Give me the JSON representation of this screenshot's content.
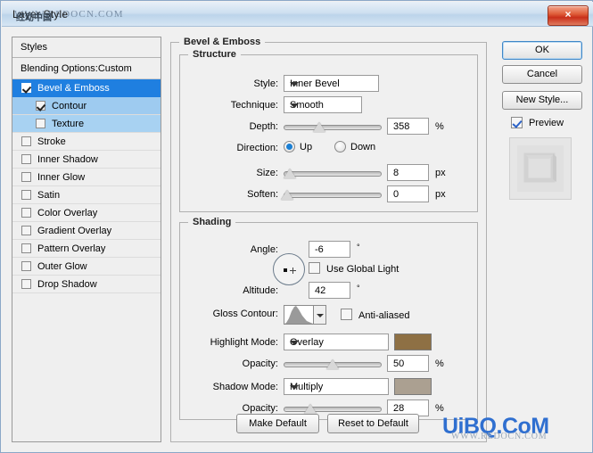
{
  "window": {
    "title": "Layer Style",
    "watermark_title": "WWW.REDOCN.COM",
    "watermark_title_cn": "红动中国",
    "close_icon": "×"
  },
  "styles_panel": {
    "header": "Styles",
    "blending_options": "Blending Options:Custom",
    "items": [
      {
        "label": "Bevel & Emboss",
        "checked": true,
        "selected": true,
        "level": 0
      },
      {
        "label": "Contour",
        "checked": true,
        "selected": false,
        "level": 1
      },
      {
        "label": "Texture",
        "checked": false,
        "selected": false,
        "level": 1
      },
      {
        "label": "Stroke",
        "checked": false,
        "selected": false,
        "level": 0
      },
      {
        "label": "Inner Shadow",
        "checked": false,
        "selected": false,
        "level": 0
      },
      {
        "label": "Inner Glow",
        "checked": false,
        "selected": false,
        "level": 0
      },
      {
        "label": "Satin",
        "checked": false,
        "selected": false,
        "level": 0
      },
      {
        "label": "Color Overlay",
        "checked": false,
        "selected": false,
        "level": 0
      },
      {
        "label": "Gradient Overlay",
        "checked": false,
        "selected": false,
        "level": 0
      },
      {
        "label": "Pattern Overlay",
        "checked": false,
        "selected": false,
        "level": 0
      },
      {
        "label": "Outer Glow",
        "checked": false,
        "selected": false,
        "level": 0
      },
      {
        "label": "Drop Shadow",
        "checked": false,
        "selected": false,
        "level": 0
      }
    ]
  },
  "main": {
    "section_title": "Bevel & Emboss",
    "structure": {
      "title": "Structure",
      "style_label": "Style:",
      "style_value": "Inner Bevel",
      "technique_label": "Technique:",
      "technique_value": "Smooth",
      "depth_label": "Depth:",
      "depth_value": "358",
      "depth_unit": "%",
      "depth_pct": 36,
      "direction_label": "Direction:",
      "direction_up": "Up",
      "direction_down": "Down",
      "direction_selected": "Up",
      "size_label": "Size:",
      "size_value": "8",
      "size_unit": "px",
      "size_pct": 5,
      "soften_label": "Soften:",
      "soften_value": "0",
      "soften_unit": "px",
      "soften_pct": 0
    },
    "shading": {
      "title": "Shading",
      "angle_label": "Angle:",
      "angle_value": "-6",
      "angle_unit": "°",
      "use_global_light": "Use Global Light",
      "use_global_light_checked": false,
      "altitude_label": "Altitude:",
      "altitude_value": "42",
      "altitude_unit": "°",
      "gloss_contour_label": "Gloss Contour:",
      "anti_aliased": "Anti-aliased",
      "anti_aliased_checked": true,
      "highlight_mode_label": "Highlight Mode:",
      "highlight_mode_value": "Overlay",
      "highlight_color": "#8e7044",
      "highlight_opacity_label": "Opacity:",
      "highlight_opacity_value": "50",
      "highlight_opacity_unit": "%",
      "highlight_opacity_pct": 50,
      "shadow_mode_label": "Shadow Mode:",
      "shadow_mode_value": "Multiply",
      "shadow_color": "#aba091",
      "shadow_opacity_label": "Opacity:",
      "shadow_opacity_value": "28",
      "shadow_opacity_unit": "%",
      "shadow_opacity_pct": 28
    }
  },
  "buttons": {
    "ok": "OK",
    "cancel": "Cancel",
    "new_style": "New Style...",
    "preview": "Preview",
    "preview_checked": true,
    "make_default": "Make Default",
    "reset_to_default": "Reset to Default"
  },
  "footer": {
    "watermark": "UiBQ.CoM",
    "watermark_sub": "WWW.REDOCN.COM"
  }
}
